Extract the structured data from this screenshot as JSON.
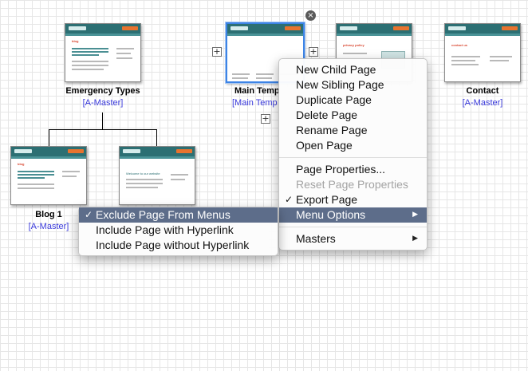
{
  "pages": [
    {
      "title": "Emergency Types",
      "master": "[A-Master]"
    },
    {
      "title": "Main Temp",
      "master": "[Main Temp"
    },
    {
      "title": "",
      "master": ""
    },
    {
      "title": "Contact",
      "master": "[A-Master]"
    },
    {
      "title": "Blog 1",
      "master": "[A-Master]"
    },
    {
      "title": "",
      "master": ""
    }
  ],
  "thumb_headings": {
    "emergency": "blog",
    "privacy": "privacy policy",
    "contact": "contact us",
    "blog1": "blog",
    "welcome": "Welcome to our website"
  },
  "icons": {
    "add": "+",
    "close": "×",
    "check": "✓",
    "submenu_arrow": "▶"
  },
  "context_menu": {
    "items": [
      {
        "label": "New Child Page"
      },
      {
        "label": "New Sibling Page"
      },
      {
        "label": "Duplicate Page"
      },
      {
        "label": "Delete Page"
      },
      {
        "label": "Rename Page"
      },
      {
        "label": "Open Page"
      },
      {
        "label": "Page Properties..."
      },
      {
        "label": "Reset Page Properties",
        "state": "disabled"
      },
      {
        "label": "Export Page",
        "state": "checked"
      },
      {
        "label": "Menu Options",
        "state": "highlighted"
      },
      {
        "label": "Masters"
      }
    ]
  },
  "submenu": {
    "items": [
      {
        "label": "Exclude Page From Menus",
        "state": "checked, highlighted"
      },
      {
        "label": "Include Page with Hyperlink"
      },
      {
        "label": "Include Page without Hyperlink"
      }
    ]
  },
  "colors": {
    "highlight": "#5d6d8a",
    "selection_border": "#3d84e6",
    "master_link": "#3b3bdc",
    "thumb_header": "#2c6f73",
    "thumb_accent": "#e8732e"
  }
}
